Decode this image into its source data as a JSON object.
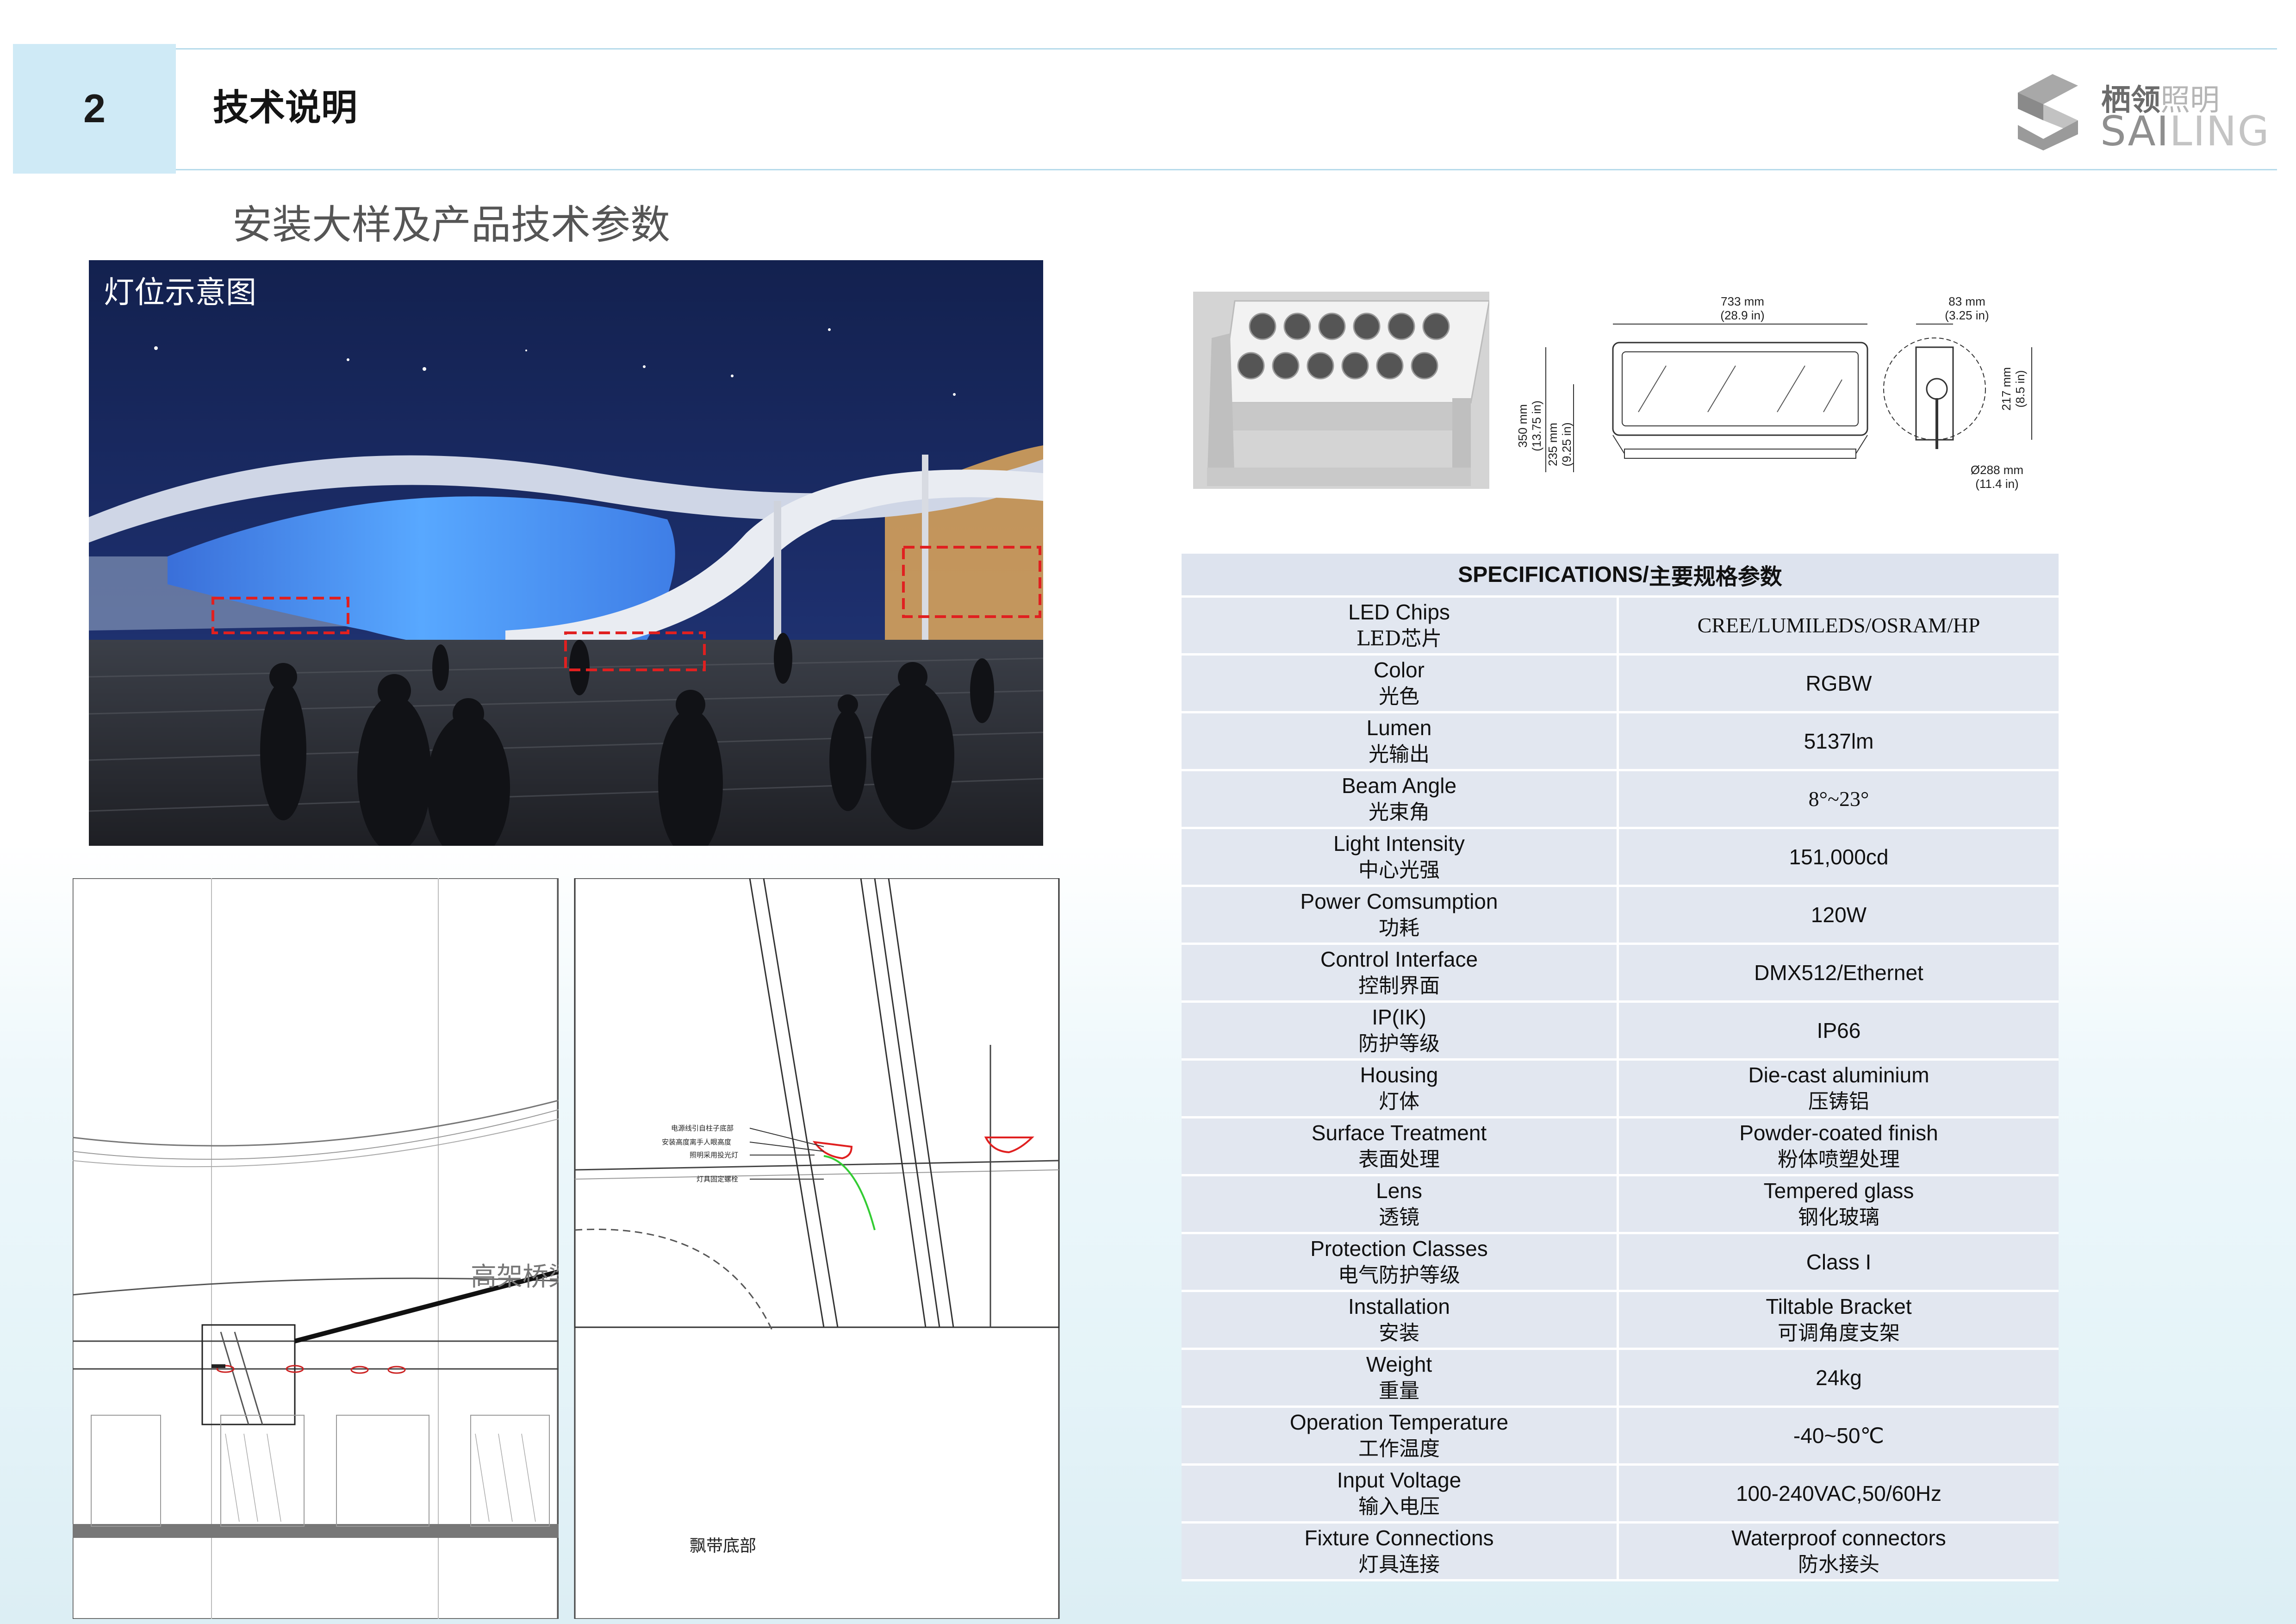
{
  "header": {
    "section_number": "2",
    "section_title": "技术说明",
    "logo_cn_1": "栖领",
    "logo_cn_2": "照明",
    "logo_en_1": "SAI",
    "logo_en_2": "LING"
  },
  "subtitle": "安装大样及产品技术参数",
  "rendering": {
    "label": "灯位示意图"
  },
  "cad": {
    "note_lines": [
      "电源线引自柱子底部",
      "安装高度离手人眼高度",
      "照明采用投光灯",
      "灯具固定螺栓"
    ],
    "left_label": "高架桥梁",
    "bottom_label": "飘带底部"
  },
  "dimensions": {
    "width": "733 mm",
    "width_in": "(28.9 in)",
    "depth": "83 mm",
    "depth_in": "(3.25 in)",
    "height_total": "350 mm",
    "height_total_in": "(13.75 in)",
    "height_body": "235 mm",
    "height_body_in": "(9.25 in)",
    "side_h": "217 mm",
    "side_h_in": "(8.5 in)",
    "dia": "Ø288 mm",
    "dia_in": "(11.4 in)"
  },
  "specs": {
    "title_en": "SPECIFICATIONS/",
    "title_cn": "主要规格参数",
    "rows": [
      {
        "en": "LED Chips",
        "cn": "LED芯片",
        "val": "CREE/LUMILEDS/OSRAM/HP",
        "val_cn": ""
      },
      {
        "en": "Color",
        "cn": "光色",
        "val": "RGBW",
        "val_cn": ""
      },
      {
        "en": "Lumen",
        "cn": "光输出",
        "val": "5137lm",
        "val_cn": ""
      },
      {
        "en": "Beam Angle",
        "cn": "光束角",
        "val": "8°~23°",
        "val_cn": ""
      },
      {
        "en": "Light Intensity",
        "cn": "中心光强",
        "val": "151,000cd",
        "val_cn": ""
      },
      {
        "en": "Power Comsumption",
        "cn": "功耗",
        "val": "120W",
        "val_cn": ""
      },
      {
        "en": "Control Interface",
        "cn": "控制界面",
        "val": "DMX512/Ethernet",
        "val_cn": ""
      },
      {
        "en": "IP(IK)",
        "cn": "防护等级",
        "val": "IP66",
        "val_cn": ""
      },
      {
        "en": "Housing",
        "cn": "灯体",
        "val": "Die-cast aluminium",
        "val_cn": "压铸铝"
      },
      {
        "en": "Surface Treatment",
        "cn": "表面处理",
        "val": "Powder-coated finish",
        "val_cn": "粉体喷塑处理"
      },
      {
        "en": "Lens",
        "cn": "透镜",
        "val": "Tempered glass",
        "val_cn": "钢化玻璃"
      },
      {
        "en": "Protection Classes",
        "cn": "电气防护等级",
        "val": "Class I",
        "val_cn": ""
      },
      {
        "en": "Installation",
        "cn": "安装",
        "val": "Tiltable Bracket",
        "val_cn": "可调角度支架"
      },
      {
        "en": "Weight",
        "cn": "重量",
        "val": "24kg",
        "val_cn": ""
      },
      {
        "en": "Operation Temperature",
        "cn": "工作温度",
        "val": "-40~50℃",
        "val_cn": ""
      },
      {
        "en": "Input Voltage",
        "cn": "输入电压",
        "val": "100-240VAC,50/60Hz",
        "val_cn": ""
      },
      {
        "en": "Fixture Connections",
        "cn": "灯具连接",
        "val": "Waterproof connectors",
        "val_cn": "防水接头"
      }
    ]
  },
  "colors": {
    "accent_light_blue": "#cfeaf6",
    "table_bg": "#e2e7f0",
    "highlight_red": "#e02020"
  }
}
